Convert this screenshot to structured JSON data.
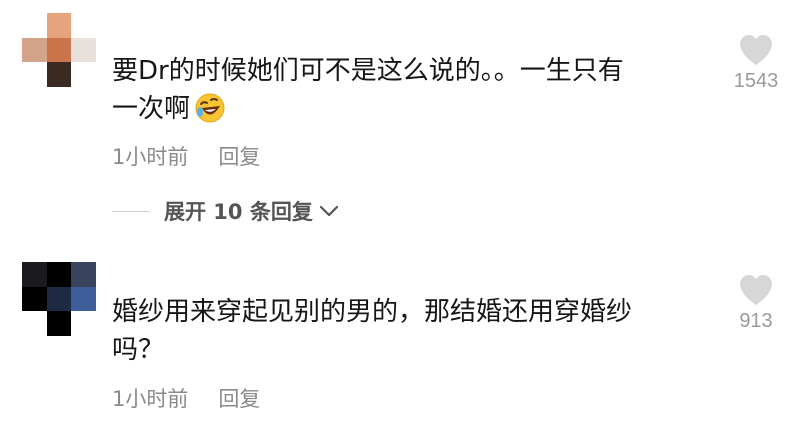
{
  "comments": [
    {
      "text_line1": "要Dr的时候她们可不是这么说的。。一生只有",
      "text_line2": "一次啊",
      "emoji_icon": "rolling-laughing-emoji",
      "time": "1小时前",
      "reply_label": "回复",
      "like_icon": "heart-icon",
      "like_count": "1543"
    },
    {
      "text_line1": "婚纱用来穿起见别的男的，那结婚还用穿婚纱",
      "text_line2": "吗？",
      "time": "1小时前",
      "reply_label": "回复",
      "like_icon": "heart-icon",
      "like_count": "913"
    }
  ],
  "expand_replies": {
    "label": "展开 10 条回复",
    "icon": "chevron-down-icon"
  }
}
